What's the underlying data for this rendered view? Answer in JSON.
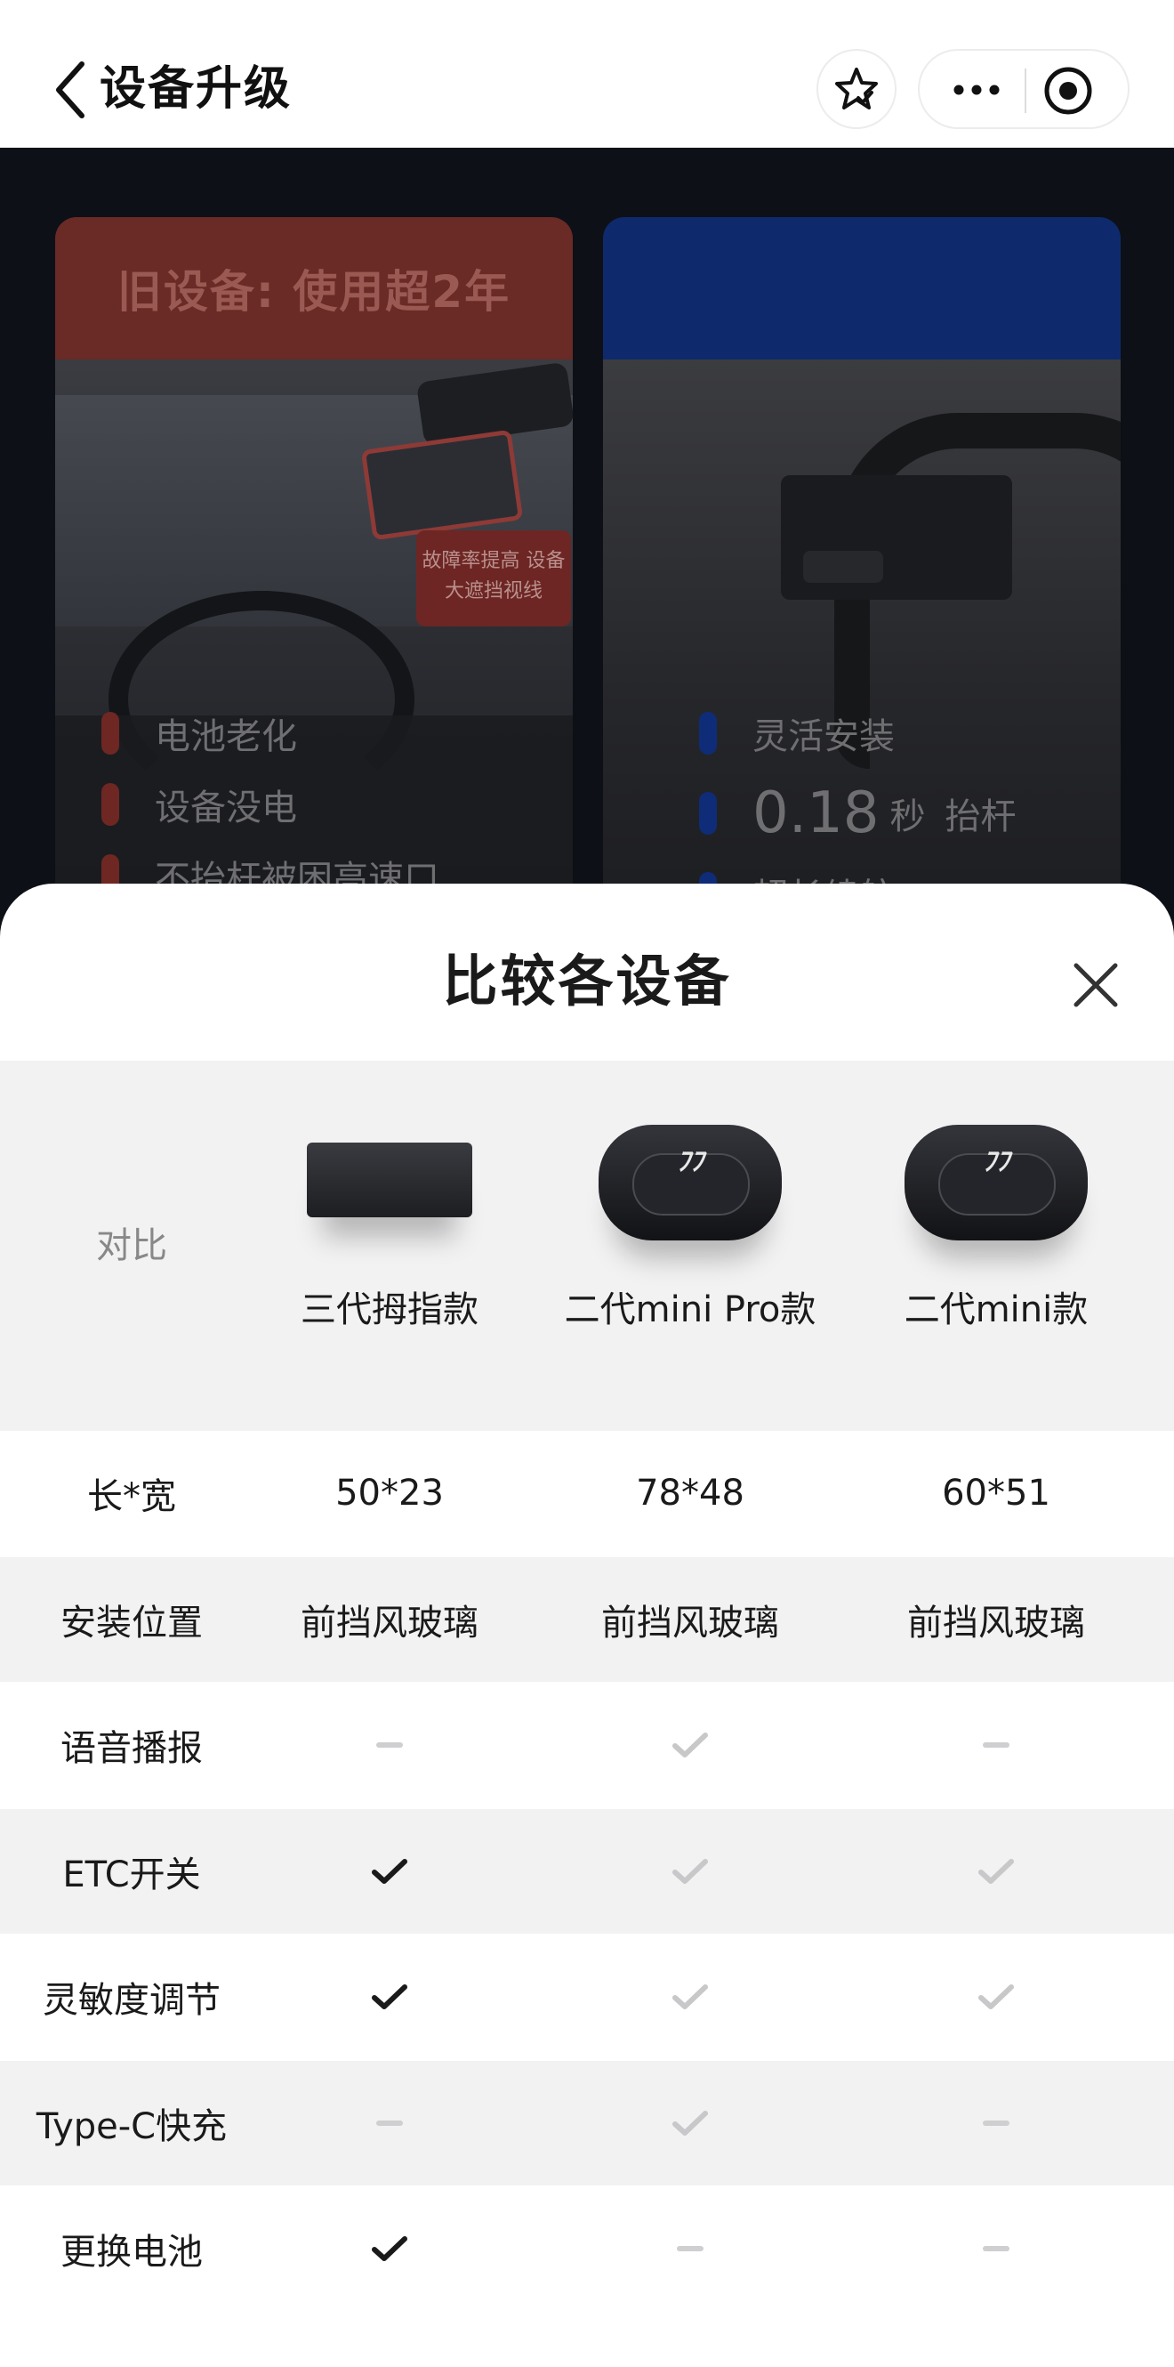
{
  "nav": {
    "title": "设备升级"
  },
  "background": {
    "card_old": {
      "header": "旧设备: 使用超2年",
      "warning": "故障率提高 设备大遮挡视线",
      "features": [
        "电池老化",
        "设备没电",
        "不抬杆被困高速口"
      ]
    },
    "card_new": {
      "features_1": "灵活安装",
      "speed_value": "0.18",
      "speed_unit": "秒",
      "speed_label": "抬杆",
      "features_3": "超长续航"
    }
  },
  "sheet": {
    "title": "比较各设备",
    "compare_label": "对比",
    "devices": [
      {
        "name": "三代拇指款"
      },
      {
        "name": "二代mini Pro款"
      },
      {
        "name": "二代mini款"
      }
    ],
    "rows": [
      {
        "label": "长*宽",
        "values": [
          "50*23",
          "78*48",
          "60*51"
        ]
      },
      {
        "label": "安装位置",
        "values": [
          "前挡风玻璃",
          "前挡风玻璃",
          "前挡风玻璃"
        ]
      },
      {
        "label": "语音播报",
        "values": [
          "none",
          "yes-grey",
          "none"
        ]
      },
      {
        "label": "ETC开关",
        "values": [
          "yes",
          "yes-grey",
          "yes-grey"
        ]
      },
      {
        "label": "灵敏度调节",
        "values": [
          "yes",
          "yes-grey",
          "yes-grey"
        ]
      },
      {
        "label": "Type-C快充",
        "values": [
          "none",
          "yes-grey",
          "none"
        ]
      },
      {
        "label": "更换电池",
        "values": [
          "yes",
          "none",
          "none"
        ]
      }
    ]
  },
  "colors": {
    "check_dark": "#1a1a1a",
    "check_grey": "#c8c8ca",
    "dash": "#cfcfd1",
    "stripe": "#f2f2f3"
  },
  "icons": [
    "back-chevron-icon",
    "star-icon",
    "more-dots-icon",
    "record-icon",
    "close-icon",
    "check-icon",
    "dash-icon"
  ]
}
